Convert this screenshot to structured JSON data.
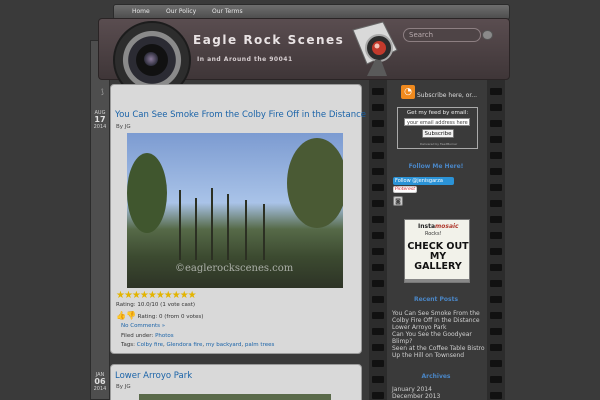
{
  "nav": {
    "items": [
      "Home",
      "Our Policy",
      "Our Terms"
    ]
  },
  "site": {
    "title": "Eagle Rock Scenes",
    "tagline": "In and Around the 90041"
  },
  "search": {
    "placeholder": "Search"
  },
  "post1": {
    "date_month": "AUG",
    "date_day": "17",
    "date_year": "2014",
    "title": "You Can See Smoke From the Colby Fire Off in the Distance",
    "byline": "By JG",
    "watermark": "©eaglerockscenes.com",
    "rating_text": "Rating: 10.0/10 (1 vote cast)",
    "rating2_text": "Rating: 0 (from 0 votes)",
    "comments": "No Comments »",
    "filed_label": "Filed under: ",
    "filed_link": "Photos",
    "tags_label": "Tags: ",
    "tags": [
      "Colby fire",
      "Glendora fire",
      "my backyard",
      "palm trees"
    ]
  },
  "post2": {
    "date_month": "JAN",
    "date_day": "06",
    "date_year": "2014",
    "title": "Lower Arroyo Park",
    "byline": "By JG"
  },
  "sidebar": {
    "rss_text": "Subscribe here, or...",
    "email_label": "Get my feed by email:",
    "email_placeholder": "your email address here",
    "subscribe_button": "Subscribe",
    "delivered": "Delivered by FeedBurner",
    "follow_head": "Follow Me Here!",
    "twitter": "Follow @jenisgarza",
    "pinterest": "Pinterest",
    "insta_brand": "Insta",
    "insta_brand2": "mosaic",
    "insta_rocks": "Rocks!",
    "insta_cta": "CHECK OUT MY GALLERY",
    "recent_head": "Recent Posts",
    "recent": [
      "You Can See Smoke From the Colby Fire Off in the Distance",
      "Lower Arroyo Park",
      "Can You See the Goodyear Blimp?",
      "Seen at the Coffee Table Bistro",
      "Up the Hill on Townsend"
    ],
    "archives_head": "Archives",
    "archives": [
      "January 2014",
      "December 2013"
    ]
  },
  "colors": {
    "link": "#1a63a8",
    "sidebar_head": "#4a86c6",
    "rss": "#f08a1e"
  }
}
